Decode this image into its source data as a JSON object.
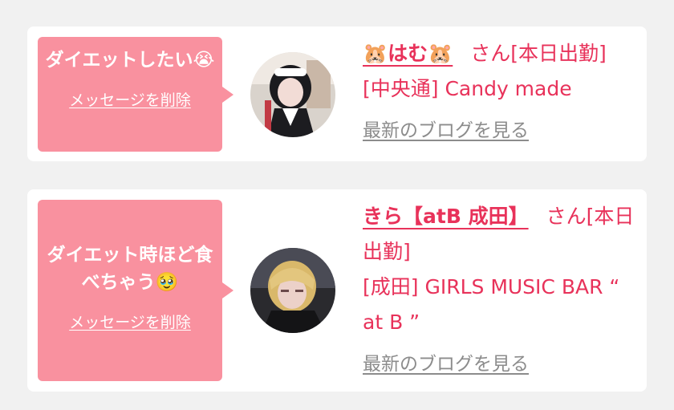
{
  "entries": [
    {
      "message": "ダイエットしたい😭",
      "delete_label": "メッセージを削除",
      "name": "🐹はむ🐹",
      "status": "さん[本日出勤]",
      "shop": "[中央通] Candy made",
      "blog_label": "最新のブログを見る"
    },
    {
      "message": "ダイエット時ほど食べちゃう🥹",
      "delete_label": "メッセージを削除",
      "name": "きら【atB 成田】",
      "status": "さん[本日出勤]",
      "shop": "[成田] GIRLS MUSIC BAR “ at B ”",
      "blog_label": "最新のブログを見る"
    }
  ],
  "colors": {
    "accent": "#e8325a",
    "bubble": "#f9919f",
    "link_gray": "#8c8c8c",
    "background": "#f1f1f1"
  }
}
